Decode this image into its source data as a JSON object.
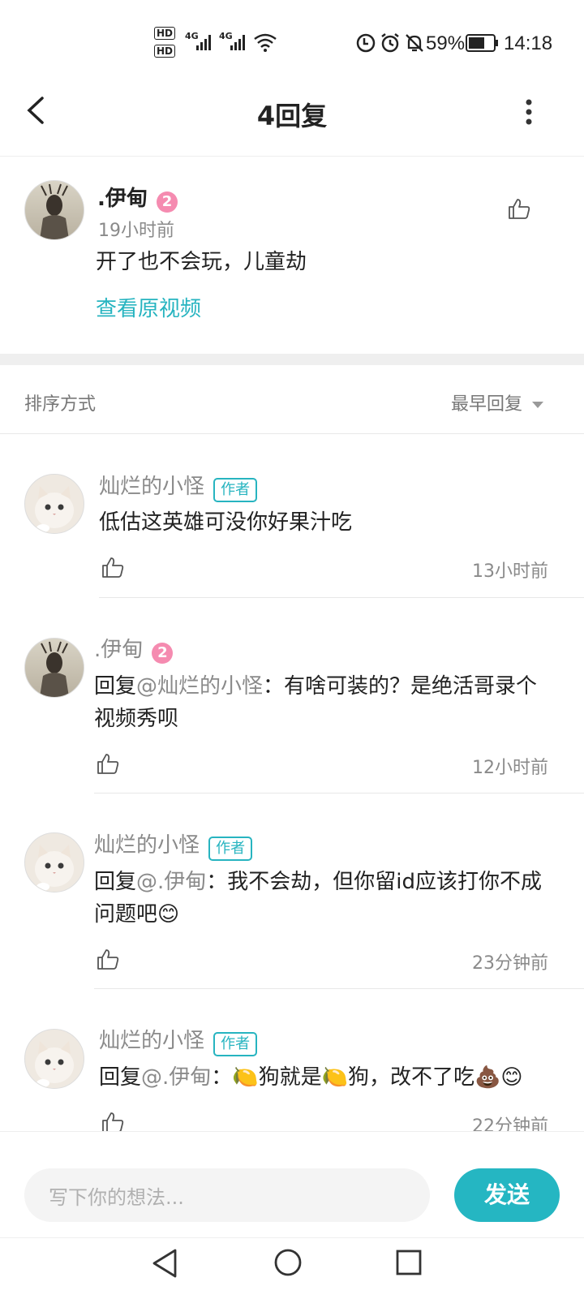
{
  "status_bar": {
    "hd1": "HD",
    "hd2": "HD",
    "net1": "4G",
    "net2": "4G",
    "battery": "59%",
    "time": "14:18"
  },
  "header": {
    "title": "4回复"
  },
  "main_comment": {
    "author": ".伊甸",
    "badge": "2",
    "time": "19小时前",
    "text": "开了也不会玩，儿童劫",
    "link": "查看原视频"
  },
  "sort": {
    "label": "排序方式",
    "selected": "最早回复"
  },
  "replies": [
    {
      "author": "灿烂的小怪",
      "tag": "作者",
      "text": "低估这英雄可没你好果汁吃",
      "time": "13小时前"
    },
    {
      "author": ".伊甸",
      "badge": "2",
      "prefix": "回复",
      "mention": "@灿烂的小怪",
      "text": "：有啥可装的？是绝活哥录个视频秀呗",
      "time": "12小时前"
    },
    {
      "author": "灿烂的小怪",
      "tag": "作者",
      "prefix": "回复",
      "mention": "@.伊甸",
      "text": "：我不会劫，但你留id应该打你不成问题吧😊",
      "time": "23分钟前"
    },
    {
      "author": "灿烂的小怪",
      "tag": "作者",
      "prefix": "回复",
      "mention": "@.伊甸",
      "text": "：🍋狗就是🍋狗，改不了吃💩😊",
      "time": "22分钟前"
    }
  ],
  "composer": {
    "placeholder": "写下你的想法...",
    "send": "发送"
  }
}
